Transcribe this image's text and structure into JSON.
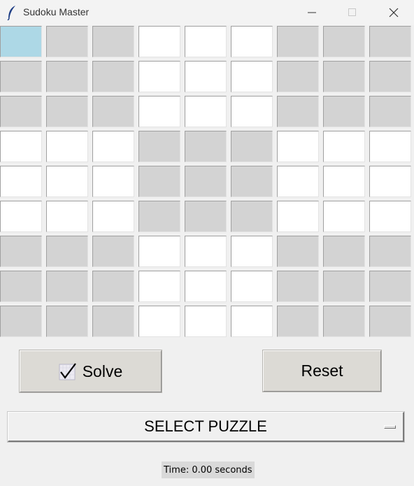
{
  "window": {
    "title": "Sudoku Master",
    "icons": {
      "app": "feather-icon",
      "minimize": "minimize-icon",
      "maximize": "maximize-icon",
      "close": "close-icon"
    }
  },
  "board": {
    "rows": 9,
    "cols": 9,
    "selected_cell": {
      "row": 0,
      "col": 0
    },
    "cells": [
      [
        "",
        "",
        "",
        "",
        "",
        "",
        "",
        "",
        ""
      ],
      [
        "",
        "",
        "",
        "",
        "",
        "",
        "",
        "",
        ""
      ],
      [
        "",
        "",
        "",
        "",
        "",
        "",
        "",
        "",
        ""
      ],
      [
        "",
        "",
        "",
        "",
        "",
        "",
        "",
        "",
        ""
      ],
      [
        "",
        "",
        "",
        "",
        "",
        "",
        "",
        "",
        ""
      ],
      [
        "",
        "",
        "",
        "",
        "",
        "",
        "",
        "",
        ""
      ],
      [
        "",
        "",
        "",
        "",
        "",
        "",
        "",
        "",
        ""
      ],
      [
        "",
        "",
        "",
        "",
        "",
        "",
        "",
        "",
        ""
      ],
      [
        "",
        "",
        "",
        "",
        "",
        "",
        "",
        "",
        ""
      ]
    ],
    "colors": {
      "shaded": "#d3d3d3",
      "plain": "#ffffff",
      "selected": "#add8e6"
    }
  },
  "controls": {
    "solve_label": "Solve",
    "solve_icon": "checkmark-icon",
    "reset_label": "Reset",
    "select_puzzle_label": "SELECT PUZZLE"
  },
  "status": {
    "timer_text": "Time: 0.00 seconds"
  }
}
